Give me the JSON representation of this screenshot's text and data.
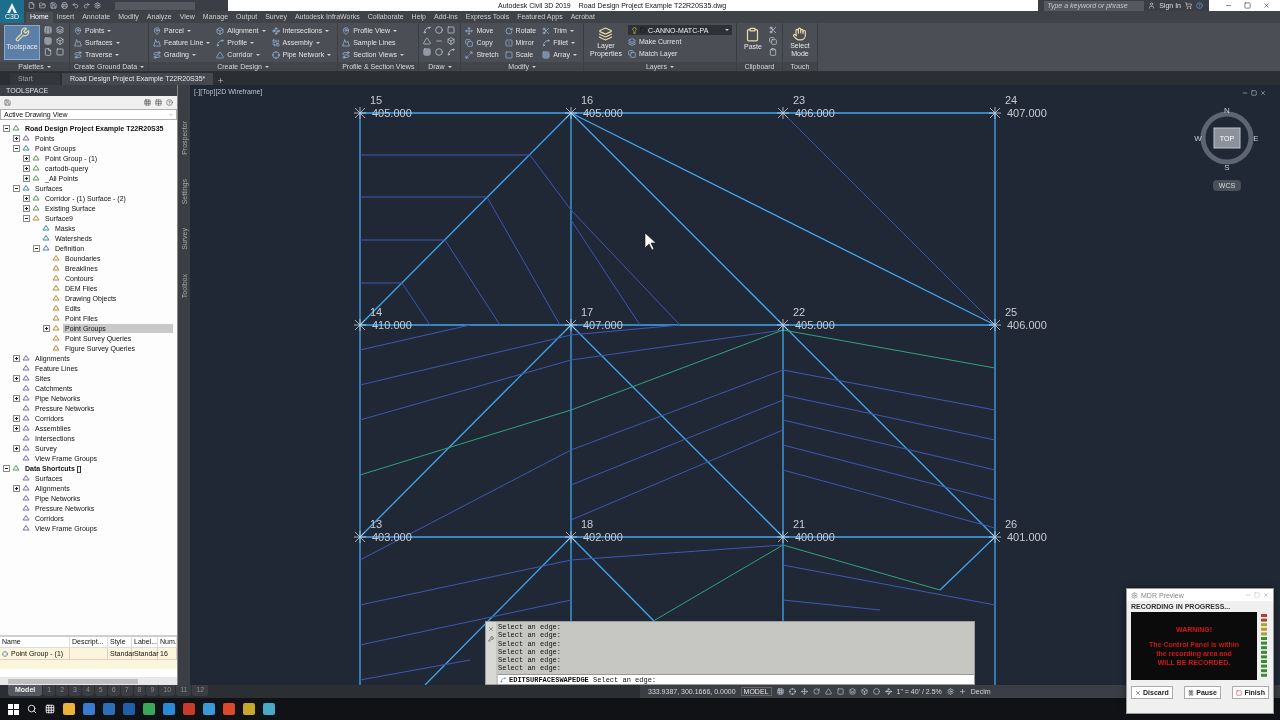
{
  "title_bar": {
    "app_badge": "C3D",
    "app_title": "Autodesk Civil 3D 2019",
    "document_title": "Road Design Project Example T22R20S35.dwg",
    "search": {
      "placeholder": "Type a keyword or phrase"
    },
    "sign_in": "Sign In"
  },
  "ribbon_tabs": [
    {
      "label": "Home",
      "selected": true
    },
    {
      "label": "Insert",
      "selected": false
    },
    {
      "label": "Annotate",
      "selected": false
    },
    {
      "label": "Modify",
      "selected": false
    },
    {
      "label": "Analyze",
      "selected": false
    },
    {
      "label": "View",
      "selected": false
    },
    {
      "label": "Manage",
      "selected": false
    },
    {
      "label": "Output",
      "selected": false
    },
    {
      "label": "Survey",
      "selected": false
    },
    {
      "label": "Autodesk InfraWorks",
      "selected": false
    },
    {
      "label": "Collaborate",
      "selected": false
    },
    {
      "label": "Help",
      "selected": false
    },
    {
      "label": "Add-ins",
      "selected": false
    },
    {
      "label": "Express Tools",
      "selected": false
    },
    {
      "label": "Featured Apps",
      "selected": false
    },
    {
      "label": "Acrobat",
      "selected": false
    }
  ],
  "ribbon_panels": [
    {
      "kind": "palettes",
      "title": "Palettes",
      "dropdown": true,
      "large": [
        {
          "label": "Toolspace",
          "selected": true
        }
      ]
    },
    {
      "kind": "standard",
      "title": "Create Ground Data",
      "dropdown": true,
      "columns": [
        [
          {
            "label": "Points",
            "dropdown": true
          },
          {
            "label": "Surfaces",
            "dropdown": true
          },
          {
            "label": "Traverse",
            "dropdown": true
          }
        ]
      ]
    },
    {
      "kind": "standard",
      "title": "Create Design",
      "dropdown": true,
      "columns": [
        [
          {
            "label": "Parcel",
            "dropdown": true
          },
          {
            "label": "Feature Line",
            "dropdown": true
          },
          {
            "label": "Grading",
            "dropdown": true
          }
        ],
        [
          {
            "label": "Alignment",
            "dropdown": true
          },
          {
            "label": "Profile",
            "dropdown": true
          },
          {
            "label": "Corridor",
            "dropdown": true
          }
        ],
        [
          {
            "label": "Intersections",
            "dropdown": true
          },
          {
            "label": "Assembly",
            "dropdown": true
          },
          {
            "label": "Pipe Network",
            "dropdown": true
          }
        ]
      ]
    },
    {
      "kind": "standard",
      "title": "Profile & Section Views",
      "dropdown": false,
      "columns": [
        [
          {
            "label": "Profile View",
            "dropdown": true
          },
          {
            "label": "Sample Lines",
            "dropdown": false
          },
          {
            "label": "Section Views",
            "dropdown": true
          }
        ]
      ]
    },
    {
      "kind": "draw",
      "title": "Draw",
      "dropdown": true
    },
    {
      "kind": "standard",
      "title": "Modify",
      "dropdown": true,
      "columns": [
        [
          {
            "label": "Move",
            "dropdown": false
          },
          {
            "label": "Copy",
            "dropdown": false
          },
          {
            "label": "Stretch",
            "dropdown": false
          }
        ],
        [
          {
            "label": "Rotate",
            "dropdown": false
          },
          {
            "label": "Mirror",
            "dropdown": false
          },
          {
            "label": "Scale",
            "dropdown": false
          }
        ],
        [
          {
            "label": "Trim",
            "dropdown": true
          },
          {
            "label": "Fillet",
            "dropdown": true
          },
          {
            "label": "Array",
            "dropdown": true
          }
        ]
      ]
    },
    {
      "kind": "layers",
      "title": "Layers",
      "dropdown": true,
      "large": [
        {
          "label": "Layer Properties",
          "selected": false
        }
      ],
      "layer": "C-ANNO-MATC-PA",
      "columns": [
        [
          {
            "label": "Make Current",
            "dropdown": false
          },
          {
            "label": "Match Layer",
            "dropdown": false
          }
        ]
      ]
    },
    {
      "kind": "clipboard",
      "title": "Clipboard",
      "dropdown": false,
      "large": [
        {
          "label": "Paste",
          "selected": false
        }
      ]
    },
    {
      "kind": "touch",
      "title": "Touch",
      "dropdown": false,
      "large": [
        {
          "label": "Select Mode",
          "selected": false
        }
      ]
    }
  ],
  "file_tabs": [
    {
      "label": "Start",
      "selected": false
    },
    {
      "label": "Road Design Project Example T22R20S35*",
      "selected": true
    }
  ],
  "toolspace": {
    "title": "TOOLSPACE",
    "view": "Active Drawing View",
    "side_tabs": [
      "Prospector",
      "Settings",
      "Survey",
      "Toolbox"
    ],
    "tree": [
      {
        "label": "Road Design Project Example T22R20S35",
        "expanded": true,
        "selected": false,
        "children": [
          {
            "label": "Points",
            "expanded": false,
            "selected": false
          },
          {
            "label": "Point Groups",
            "expanded": true,
            "selected": false,
            "children": [
              {
                "label": "Point Group - (1)",
                "expanded": false,
                "selected": false
              },
              {
                "label": "cartodb-query",
                "expanded": false,
                "selected": false
              },
              {
                "label": "_All Points",
                "expanded": false,
                "selected": false
              }
            ]
          },
          {
            "label": "Surfaces",
            "expanded": true,
            "selected": false,
            "children": [
              {
                "label": "Corridor - (1) Surface - (2)",
                "expanded": false,
                "selected": false
              },
              {
                "label": "Existing Surface",
                "expanded": false,
                "selected": false
              },
              {
                "label": "Surface9",
                "expanded": true,
                "selected": false,
                "children": [
                  {
                    "label": "Masks",
                    "selected": false
                  },
                  {
                    "label": "Watersheds",
                    "selected": false
                  },
                  {
                    "label": "Definition",
                    "expanded": true,
                    "selected": false,
                    "children": [
                      {
                        "label": "Boundaries",
                        "selected": false
                      },
                      {
                        "label": "Breaklines",
                        "selected": false
                      },
                      {
                        "label": "Contours",
                        "selected": false
                      },
                      {
                        "label": "DEM Files",
                        "selected": false
                      },
                      {
                        "label": "Drawing Objects",
                        "selected": false
                      },
                      {
                        "label": "Edits",
                        "selected": false
                      },
                      {
                        "label": "Point Files",
                        "selected": false
                      },
                      {
                        "label": "Point Groups",
                        "expanded": false,
                        "selected": true
                      },
                      {
                        "label": "Point Survey Queries",
                        "selected": false
                      },
                      {
                        "label": "Figure Survey Queries",
                        "selected": false
                      }
                    ]
                  }
                ]
              }
            ]
          },
          {
            "label": "Alignments",
            "expanded": false,
            "selected": false
          },
          {
            "label": "Feature Lines",
            "selected": false
          },
          {
            "label": "Sites",
            "expanded": false,
            "selected": false
          },
          {
            "label": "Catchments",
            "selected": false
          },
          {
            "label": "Pipe Networks",
            "expanded": false,
            "selected": false
          },
          {
            "label": "Pressure Networks",
            "selected": false
          },
          {
            "label": "Corridors",
            "expanded": false,
            "selected": false
          },
          {
            "label": "Assemblies",
            "expanded": false,
            "selected": false
          },
          {
            "label": "Intersections",
            "selected": false
          },
          {
            "label": "Survey",
            "expanded": false,
            "selected": false
          },
          {
            "label": "View Frame Groups",
            "selected": false
          }
        ]
      },
      {
        "label": "Data Shortcuts []",
        "expanded": true,
        "selected": false,
        "children": [
          {
            "label": "Surfaces",
            "selected": false
          },
          {
            "label": "Alignments",
            "expanded": false,
            "selected": false
          },
          {
            "label": "Pipe Networks",
            "selected": false
          },
          {
            "label": "Pressure Networks",
            "selected": false
          },
          {
            "label": "Corridors",
            "selected": false
          },
          {
            "label": "View Frame Groups",
            "selected": false
          }
        ]
      }
    ],
    "table": {
      "columns": [
        "Name",
        "Descript...",
        "Style",
        "Label...",
        "Num."
      ],
      "rows": [
        [
          "Point Group - (1)",
          "",
          "Standar",
          "Standar",
          "16"
        ]
      ]
    }
  },
  "viewport": {
    "label": "[-][Top][2D Wireframe]",
    "points": [
      {
        "number": "15",
        "elevation": "405.000"
      },
      {
        "number": "16",
        "elevation": "405.000"
      },
      {
        "number": "23",
        "elevation": "406.000"
      },
      {
        "number": "24",
        "elevation": "407.000"
      },
      {
        "number": "14",
        "elevation": "410.000"
      },
      {
        "number": "17",
        "elevation": "407.000"
      },
      {
        "number": "22",
        "elevation": "405.000"
      },
      {
        "number": "25",
        "elevation": "406.000"
      },
      {
        "number": "13",
        "elevation": "403.000"
      },
      {
        "number": "18",
        "elevation": "402.000"
      },
      {
        "number": "21",
        "elevation": "400.000"
      },
      {
        "number": "26",
        "elevation": "401.000"
      }
    ],
    "viewcube": {
      "top": "TOP",
      "north": "N",
      "south": "S",
      "east": "E",
      "west": "W",
      "ucs": "WCS"
    }
  },
  "command_line": {
    "history": [
      "Select an edge:",
      "Select an edge:",
      "Select an edge:",
      "Select an edge:",
      "Select an edge:",
      "Select an edge:"
    ],
    "command": "EDITSURFACESWAPEDGE",
    "prompt": "Select an edge:"
  },
  "layout_tabs": [
    {
      "label": "Model",
      "selected": true
    },
    {
      "label": "1",
      "selected": false
    },
    {
      "label": "2",
      "selected": false
    },
    {
      "label": "3",
      "selected": false
    },
    {
      "label": "4",
      "selected": false
    },
    {
      "label": "5",
      "selected": false
    },
    {
      "label": "6",
      "selected": false
    },
    {
      "label": "7",
      "selected": false
    },
    {
      "label": "8",
      "selected": false
    },
    {
      "label": "9",
      "selected": false
    },
    {
      "label": "10",
      "selected": false
    },
    {
      "label": "11",
      "selected": false
    },
    {
      "label": "12",
      "selected": false
    }
  ],
  "status_bar": {
    "coordinates": "333.9387, 300.1666, 0.0000",
    "space": "MODEL",
    "scale": "1\" = 40' / 2.5%",
    "units": "Decim"
  },
  "recorder": {
    "title": "MDR Preview",
    "status": "RECORDING IN PROGRESS...",
    "warning_title": "WARNING!",
    "warning_lines": [
      "The Control Panel is within",
      "the recording area and",
      "WILL BE RECORDED."
    ],
    "buttons": [
      {
        "label": "Discard",
        "kind": "discard"
      },
      {
        "label": "Pause",
        "kind": "pause"
      },
      {
        "label": "Finish",
        "kind": "finish"
      }
    ]
  }
}
